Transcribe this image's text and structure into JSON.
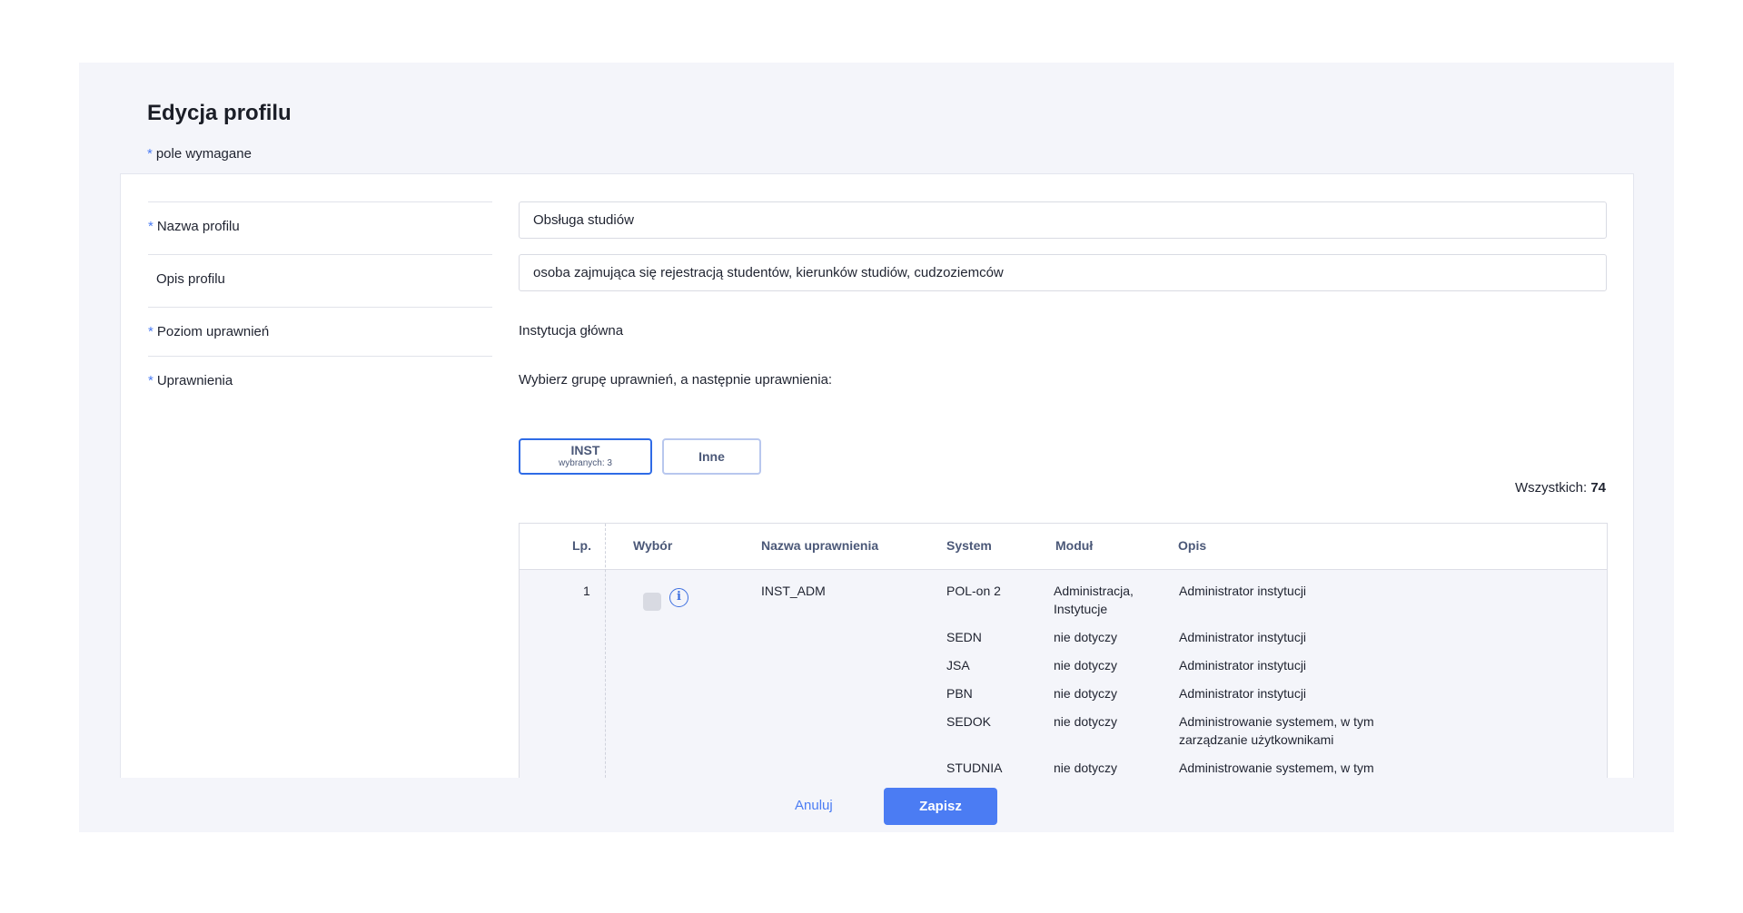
{
  "page": {
    "title": "Edycja profilu",
    "required_note": "pole wymagane",
    "required_mark": "*"
  },
  "form": {
    "name_label": "Nazwa profilu",
    "name_value": "Obsługa studiów",
    "desc_label": "Opis profilu",
    "desc_value": "osoba zajmująca się rejestracją studentów, kierunków studiów, cudzoziemców",
    "level_label": "Poziom uprawnień",
    "level_value": "Instytucja główna",
    "perms_label": "Uprawnienia",
    "perms_instruction": "Wybierz grupę uprawnień, a następnie uprawnienia:"
  },
  "groups": [
    {
      "label": "INST",
      "sub": "wybranych: 3",
      "active": true
    },
    {
      "label": "Inne",
      "sub": "",
      "active": false
    }
  ],
  "total": {
    "label": "Wszystkich:",
    "value": "74"
  },
  "table": {
    "headers": {
      "lp": "Lp.",
      "choice": "Wybór",
      "name": "Nazwa uprawnienia",
      "system": "System",
      "module": "Moduł",
      "desc": "Opis"
    },
    "row1": {
      "lp": "1",
      "name": "INST_ADM",
      "entries": [
        {
          "system": "POL-on 2",
          "module_l1": "Administracja,",
          "module_l2": "Instytucje",
          "desc_l1": "Administrator instytucji",
          "desc_l2": ""
        },
        {
          "system": "SEDN",
          "module_l1": "nie dotyczy",
          "module_l2": "",
          "desc_l1": "Administrator instytucji",
          "desc_l2": ""
        },
        {
          "system": "JSA",
          "module_l1": "nie dotyczy",
          "module_l2": "",
          "desc_l1": "Administrator instytucji",
          "desc_l2": ""
        },
        {
          "system": "PBN",
          "module_l1": "nie dotyczy",
          "module_l2": "",
          "desc_l1": "Administrator instytucji",
          "desc_l2": ""
        },
        {
          "system": "SEDOK",
          "module_l1": "nie dotyczy",
          "module_l2": "",
          "desc_l1": "Administrowanie systemem, w tym",
          "desc_l2": "zarządzanie użytkownikami"
        },
        {
          "system": "STUDNIA",
          "module_l1": "nie dotyczy",
          "module_l2": "",
          "desc_l1": "Administrowanie systemem, w tym",
          "desc_l2": ""
        }
      ]
    }
  },
  "footer": {
    "cancel": "Anuluj",
    "save": "Zapisz"
  },
  "colors": {
    "accent": "#4b7cf3",
    "panel_bg": "#f4f5fa",
    "active_border": "#2f6be6"
  },
  "icons": {
    "info": "info-circle-icon"
  }
}
